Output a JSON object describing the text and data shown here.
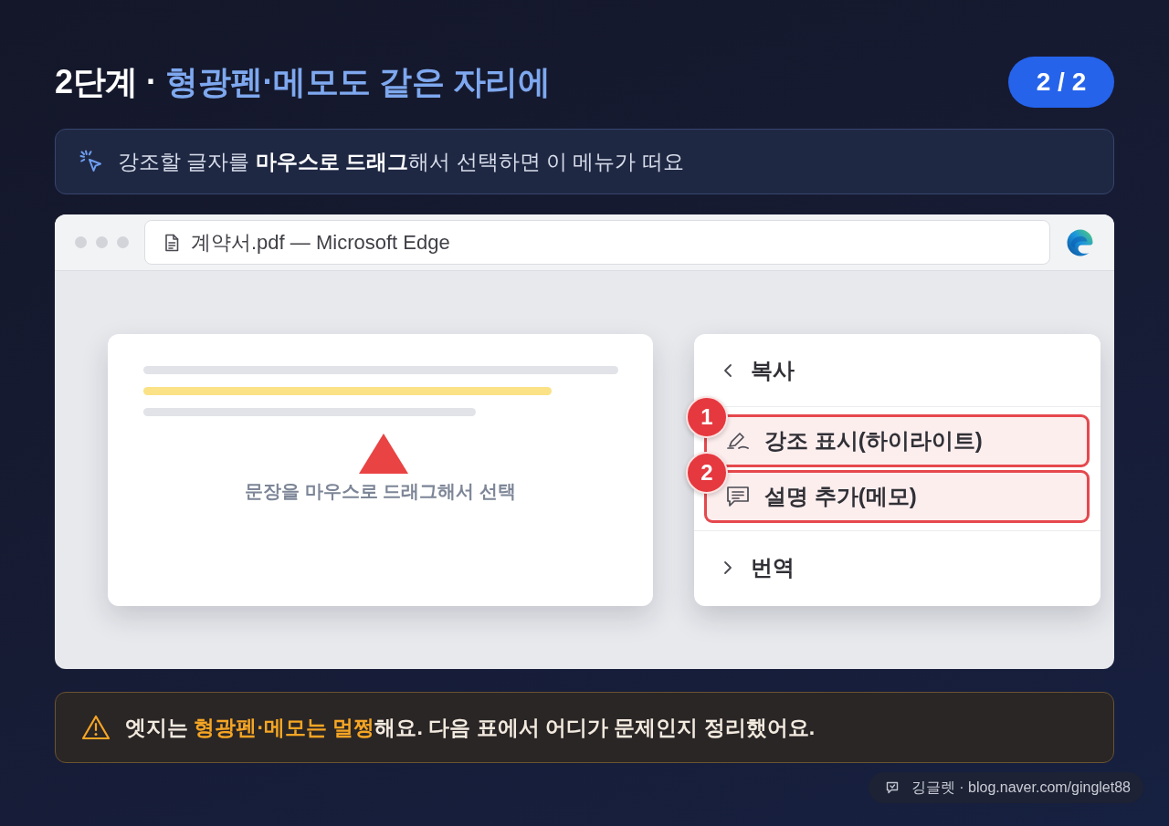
{
  "header": {
    "title": [
      {
        "text": "2단계 · ",
        "accent": false
      },
      {
        "text": "형광펜·메모도 같은 자리에",
        "accent": true
      }
    ],
    "page_indicator": "2 / 2"
  },
  "hint": {
    "text": "강조할 글자를 **마우스로 드래그**해서 선택하면 이 메뉴가 떠요"
  },
  "browser": {
    "title": "계약서.pdf — Microsoft Edge",
    "document": {
      "lines": [
        {
          "highlighted": false
        },
        {
          "highlighted": true
        },
        {
          "highlighted": false
        }
      ],
      "caption": "문장을 마우스로 드래그해서 선택"
    },
    "context_menu": {
      "items": [
        {
          "label": "복사",
          "kind": "back"
        },
        {
          "label": "강조 표시(하이라이트)",
          "kind": "highlight",
          "callout": "1"
        },
        {
          "label": "설명 추가(메모)",
          "kind": "note",
          "callout": "2"
        },
        {
          "label": "번역",
          "kind": "forward"
        }
      ]
    }
  },
  "notice": {
    "segments": [
      {
        "text": "엣지는 ",
        "accent": false
      },
      {
        "text": "형광펜·메모는 멀쩡",
        "accent": true
      },
      {
        "text": "해요. 다음 표에서 어디가 문제인지 정리했어요.",
        "accent": false
      }
    ]
  },
  "credit": {
    "text": "깅글렛 · blog.naver.com/ginglet88"
  }
}
